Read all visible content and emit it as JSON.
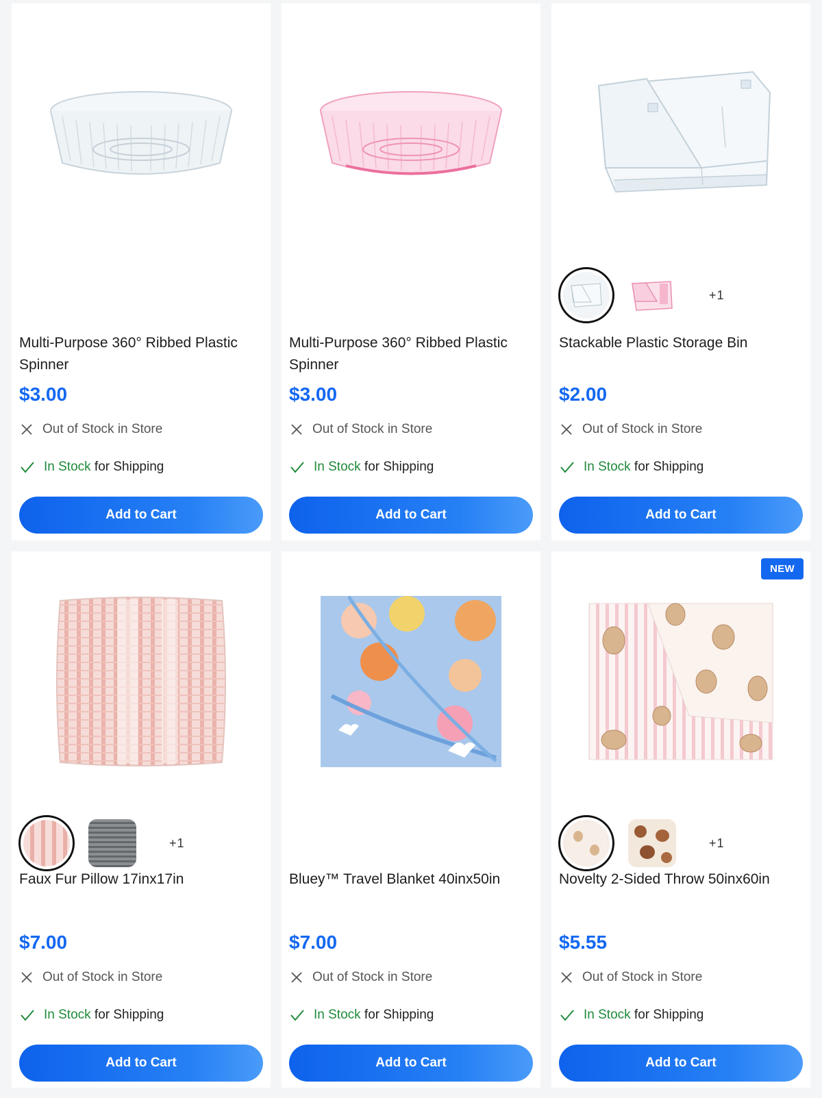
{
  "products": [
    {
      "name": "Multi-Purpose 360° Ribbed Plastic Spinner",
      "price": "$3.00",
      "store_status": "Out of Stock in Store",
      "ship_status_highlight": "In Stock",
      "ship_status_rest": " for Shipping",
      "button": "Add to Cart",
      "image": "clear-ribbed-spinner",
      "accent": "#d7e3ea"
    },
    {
      "name": "Multi-Purpose 360° Ribbed Plastic Spinner",
      "price": "$3.00",
      "store_status": "Out of Stock in Store",
      "ship_status_highlight": "In Stock",
      "ship_status_rest": " for Shipping",
      "button": "Add to Cart",
      "image": "pink-ribbed-spinner",
      "accent": "#f3a9c4"
    },
    {
      "name": "Stackable Plastic Storage Bin",
      "price": "$2.00",
      "store_status": "Out of Stock in Store",
      "ship_status_highlight": "In Stock",
      "ship_status_rest": " for Shipping",
      "button": "Add to Cart",
      "image": "clear-storage-bin",
      "more_swatches": "+1",
      "swatches": [
        "clear-bin",
        "pink-bin"
      ]
    },
    {
      "name": "Faux Fur Pillow 17inx17in",
      "price": "$7.00",
      "store_status": "Out of Stock in Store",
      "ship_status_highlight": "In Stock",
      "ship_status_rest": " for Shipping",
      "button": "Add to Cart",
      "image": "pink-striped-pillow",
      "more_swatches": "+1",
      "swatches": [
        "pink-stripe",
        "gray-plaid"
      ]
    },
    {
      "name": "Bluey™ Travel Blanket 40inx50in",
      "price": "$7.00",
      "store_status": "Out of Stock in Store",
      "ship_status_highlight": "In Stock",
      "ship_status_rest": " for Shipping",
      "button": "Add to Cart",
      "image": "bluey-blanket"
    },
    {
      "name": "Novelty 2-Sided Throw 50inx60in",
      "price": "$5.55",
      "store_status": "Out of Stock in Store",
      "ship_status_highlight": "In Stock",
      "ship_status_rest": " for Shipping",
      "button": "Add to Cart",
      "image": "bunny-throw",
      "badge": "NEW",
      "more_swatches": "+1",
      "swatches": [
        "bunny-cream",
        "bunny-brown"
      ]
    }
  ],
  "colors": {
    "brand": "#1468f0",
    "in_stock": "#1f8a3a",
    "badge": "#1468f0"
  }
}
